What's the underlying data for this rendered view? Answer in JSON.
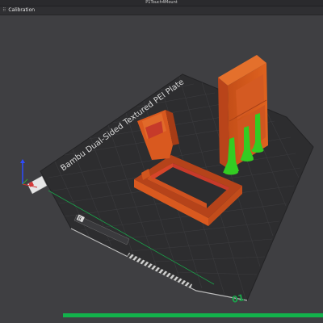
{
  "window": {
    "title": "P1Touch4Mount"
  },
  "tabs": [
    {
      "label": "Calibration"
    }
  ],
  "plate": {
    "name": "Bambu Dual-Sided Textured PEI Plate",
    "number": "01",
    "logo_text": "B"
  },
  "status": {
    "progress": 1.0
  },
  "colors": {
    "background": "#3f3f42",
    "plate": "#2b2b2d",
    "grid": "#3a3a3d",
    "model": "#d0551e",
    "support": "#33cc22",
    "plate_border": "#19a64a",
    "progress": "#12b24b"
  },
  "icons": {
    "tab_menu": "drag-dots-icon"
  }
}
